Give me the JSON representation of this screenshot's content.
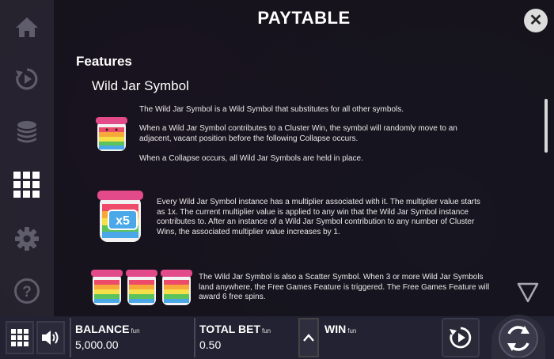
{
  "paytable": {
    "title": "PAYTABLE",
    "close_icon": "close-icon",
    "section_title": "Features",
    "subsection_title": "Wild Jar Symbol",
    "paragraphs": [
      "The Wild Jar Symbol is a Wild Symbol that substitutes for all other symbols.",
      "When a Wild Jar Symbol contributes to a Cluster Win, the symbol will randomly move to an adjacent, vacant position before the following Collapse occurs.",
      "When a Collapse occurs, all Wild Jar Symbols are held in place.",
      "Every Wild Jar Symbol instance has a multiplier associated with it. The multiplier value starts as 1x. The current multiplier value is applied to any win that the Wild Jar Symbol instance contributes to. After an instance of a Wild Jar Symbol contribution to any number of Cluster Wins, the associated multiplier value increases by 1.",
      "The Wild Jar Symbol is also a Scatter Symbol. When 3 or more Wild Jar Symbols land anywhere, the Free Games Feature is triggered. The Free Games Feature will award 6 free spins."
    ],
    "multiplier_badge": "x5"
  },
  "sidebar": {
    "items": [
      {
        "icon": "home-icon"
      },
      {
        "icon": "replay-icon"
      },
      {
        "icon": "coins-icon"
      },
      {
        "icon": "paytable-grid-icon",
        "active": true
      },
      {
        "icon": "settings-gear-icon"
      },
      {
        "icon": "help-icon"
      }
    ]
  },
  "bottombar": {
    "balance_label": "BALANCE",
    "balance_unit": "fun",
    "balance_value": "5,000.00",
    "totalbet_label": "TOTAL BET",
    "totalbet_unit": "fun",
    "totalbet_value": "0.50",
    "win_label": "WIN",
    "win_unit": "fun"
  },
  "colors": {
    "panel_bg": "#14121a",
    "bottombar_bg": "#232232",
    "jar_lid": "#e24a8a",
    "jar_badge": "#4aa8e8"
  }
}
